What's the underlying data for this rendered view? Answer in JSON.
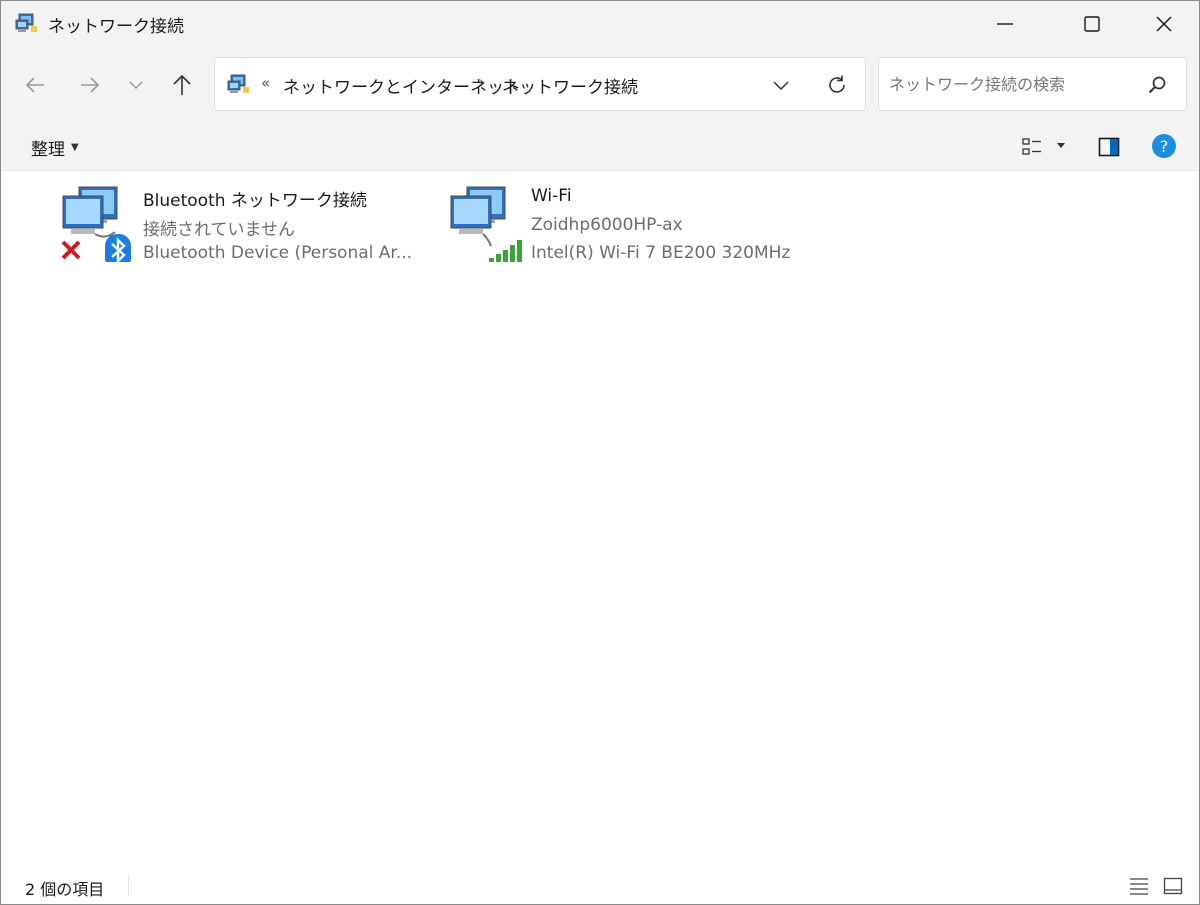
{
  "window": {
    "title": "ネットワーク接続",
    "minimize_icon": "minimize-icon",
    "maximize_icon": "maximize-icon",
    "close_icon": "close-icon"
  },
  "nav": {
    "back_icon": "arrow-left-icon",
    "forward_icon": "arrow-right-icon",
    "recent_icon": "chevron-down-icon",
    "up_icon": "arrow-up-icon"
  },
  "address": {
    "overflow": "«",
    "crumbs": [
      "ネットワークとインターネット",
      "ネットワーク接続"
    ],
    "separator": "›"
  },
  "search": {
    "placeholder": "ネットワーク接続の検索"
  },
  "command_bar": {
    "organize_label": "整理"
  },
  "connections": [
    {
      "name": "Bluetooth ネットワーク接続",
      "status": "接続されていません",
      "device": "Bluetooth Device (Personal Ar...",
      "state_icon": "disconnected-x-icon",
      "badge_icon": "bluetooth-icon"
    },
    {
      "name": "Wi-Fi",
      "status": "Zoidhp6000HP-ax",
      "device": "Intel(R) Wi-Fi 7 BE200 320MHz",
      "state_icon": "signal-bars-icon",
      "signal_bars": 5
    }
  ],
  "status_bar": {
    "count": "2 個の項目"
  },
  "colors": {
    "chrome_bg": "#f3f3f3",
    "accent_blue": "#0067c0",
    "help_blue": "#1a8ee0",
    "error_red": "#d11a1a",
    "signal_green": "#3aa33a"
  }
}
